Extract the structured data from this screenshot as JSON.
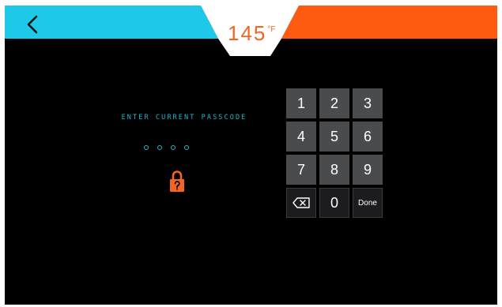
{
  "header": {
    "back_icon": "chevron-left-icon",
    "temperature_value": "145",
    "temperature_unit": "°F",
    "left_color": "#1ec8e8",
    "right_color": "#ff5a12",
    "value_color": "#f26522"
  },
  "passcode": {
    "prompt": "ENTER CURRENT PASSCODE",
    "digit_slots": 4,
    "accent_color": "#1fb6cf",
    "lock_icon": "lock-question-icon",
    "lock_color": "#f26522"
  },
  "keypad": {
    "keys": [
      "1",
      "2",
      "3",
      "4",
      "5",
      "6",
      "7",
      "8",
      "9"
    ],
    "zero": "0",
    "done": "Done",
    "backspace_icon": "backspace-icon"
  }
}
